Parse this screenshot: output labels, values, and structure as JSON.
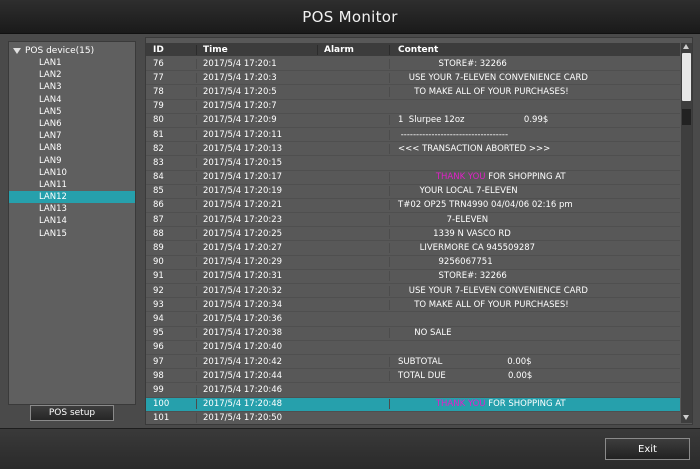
{
  "window": {
    "title": "POS Monitor"
  },
  "sidebar": {
    "root_label": "POS device(15)",
    "items": [
      "LAN1",
      "LAN2",
      "LAN3",
      "LAN4",
      "LAN5",
      "LAN6",
      "LAN7",
      "LAN8",
      "LAN9",
      "LAN10",
      "LAN11",
      "LAN12",
      "LAN13",
      "LAN14",
      "LAN15"
    ],
    "selected_index": 11,
    "setup_label": "POS setup"
  },
  "table": {
    "columns": {
      "id": "ID",
      "time": "Time",
      "alarm": "Alarm",
      "content": "Content"
    },
    "selected_id": "100",
    "rows": [
      {
        "id": "76",
        "time": "2017/5/4 17:20:1",
        "alarm": "",
        "content": "               STORE#: 32266"
      },
      {
        "id": "77",
        "time": "2017/5/4 17:20:3",
        "alarm": "",
        "content": "    USE YOUR 7-ELEVEN CONVENIENCE CARD"
      },
      {
        "id": "78",
        "time": "2017/5/4 17:20:5",
        "alarm": "",
        "content": "      TO MAKE ALL OF YOUR PURCHASES!"
      },
      {
        "id": "79",
        "time": "2017/5/4 17:20:7",
        "alarm": "",
        "content": ""
      },
      {
        "id": "80",
        "time": "2017/5/4 17:20:9",
        "alarm": "",
        "content": "1  Slurpee 12oz                      0.99$"
      },
      {
        "id": "81",
        "time": "2017/5/4 17:20:11",
        "alarm": "",
        "content": " -----------------------------------"
      },
      {
        "id": "82",
        "time": "2017/5/4 17:20:13",
        "alarm": "",
        "content": "<<< TRANSACTION ABORTED >>>"
      },
      {
        "id": "83",
        "time": "2017/5/4 17:20:15",
        "alarm": "",
        "content": ""
      },
      {
        "id": "84",
        "time": "2017/5/4 17:20:17",
        "alarm": "",
        "content_hl": "THANK YOU",
        "content": " FOR SHOPPING AT",
        "content_prefix": "              "
      },
      {
        "id": "85",
        "time": "2017/5/4 17:20:19",
        "alarm": "",
        "content": "        YOUR LOCAL 7-ELEVEN"
      },
      {
        "id": "86",
        "time": "2017/5/4 17:20:21",
        "alarm": "",
        "content": "T#02 OP25 TRN4990 04/04/06 02:16 pm"
      },
      {
        "id": "87",
        "time": "2017/5/4 17:20:23",
        "alarm": "",
        "content": "                  7-ELEVEN"
      },
      {
        "id": "88",
        "time": "2017/5/4 17:20:25",
        "alarm": "",
        "content": "             1339 N VASCO RD"
      },
      {
        "id": "89",
        "time": "2017/5/4 17:20:27",
        "alarm": "",
        "content": "        LIVERMORE CA 945509287"
      },
      {
        "id": "90",
        "time": "2017/5/4 17:20:29",
        "alarm": "",
        "content": "               9256067751"
      },
      {
        "id": "91",
        "time": "2017/5/4 17:20:31",
        "alarm": "",
        "content": "               STORE#: 32266"
      },
      {
        "id": "92",
        "time": "2017/5/4 17:20:32",
        "alarm": "",
        "content": "    USE YOUR 7-ELEVEN CONVENIENCE CARD"
      },
      {
        "id": "93",
        "time": "2017/5/4 17:20:34",
        "alarm": "",
        "content": "      TO MAKE ALL OF YOUR PURCHASES!"
      },
      {
        "id": "94",
        "time": "2017/5/4 17:20:36",
        "alarm": "",
        "content": ""
      },
      {
        "id": "95",
        "time": "2017/5/4 17:20:38",
        "alarm": "",
        "content": "      NO SALE"
      },
      {
        "id": "96",
        "time": "2017/5/4 17:20:40",
        "alarm": "",
        "content": ""
      },
      {
        "id": "97",
        "time": "2017/5/4 17:20:42",
        "alarm": "",
        "content": "SUBTOTAL                        0.00$"
      },
      {
        "id": "98",
        "time": "2017/5/4 17:20:44",
        "alarm": "",
        "content": "TOTAL DUE                       0.00$"
      },
      {
        "id": "99",
        "time": "2017/5/4 17:20:46",
        "alarm": "",
        "content": ""
      },
      {
        "id": "100",
        "time": "2017/5/4 17:20:48",
        "alarm": "",
        "content_hl": "THANK YOU",
        "content": " FOR SHOPPING AT",
        "content_prefix": "              "
      },
      {
        "id": "101",
        "time": "2017/5/4 17:20:50",
        "alarm": "",
        "content": ""
      }
    ]
  },
  "footer": {
    "exit_label": "Exit"
  },
  "colors": {
    "accent": "#26a0ac",
    "highlight_text": "#e020c8"
  }
}
